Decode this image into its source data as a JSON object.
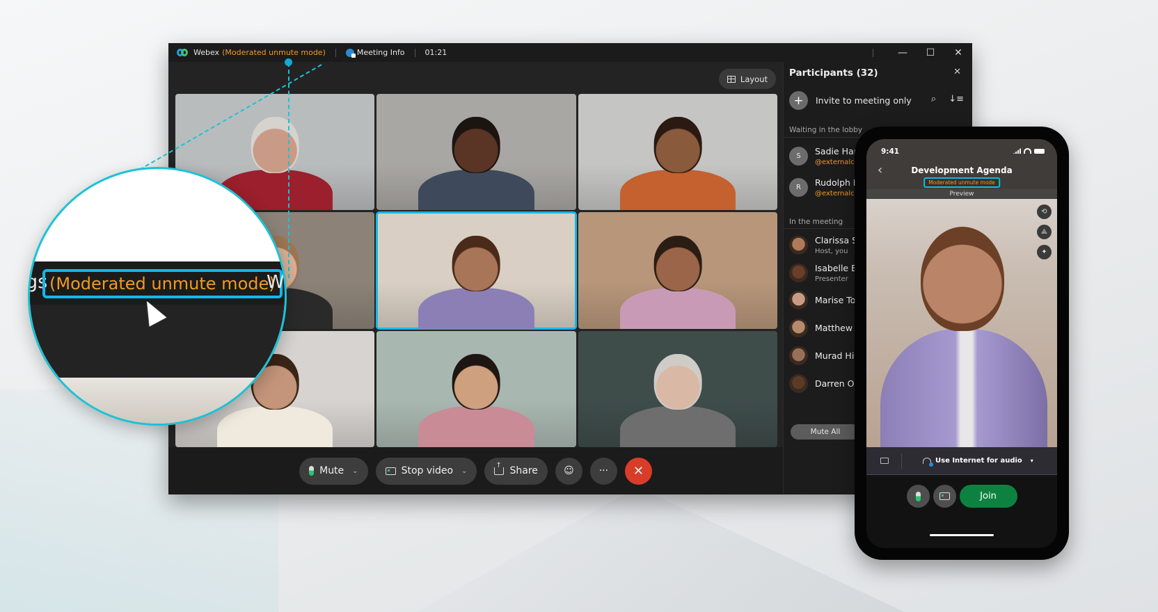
{
  "window": {
    "app_name": "Webex",
    "mode_label": "(Moderated unmute mode)",
    "meeting_info_label": "Meeting Info",
    "timer": "01:21",
    "controls": {
      "minimize": "—",
      "maximize": "☐",
      "close": "✕"
    }
  },
  "stage": {
    "layout_label": "Layout",
    "tiles": [
      {
        "name": "video-tile-1",
        "bg": "#b9bcbd",
        "skin": "#c99a85",
        "hair": "#d6d3cf",
        "clothes": "#9b1f2c",
        "active": false
      },
      {
        "name": "video-tile-2",
        "bg": "#a9a7a3",
        "skin": "#5a3424",
        "hair": "#1b1411",
        "clothes": "#3e4a5c",
        "active": false
      },
      {
        "name": "video-tile-3",
        "bg": "#c5c5c3",
        "skin": "#8a5a3d",
        "hair": "#2a1a12",
        "clothes": "#c4612f",
        "active": false
      },
      {
        "name": "video-tile-4",
        "bg": "#8c8278",
        "skin": "#d8b096",
        "hair": "#9e7552",
        "clothes": "#2a2a2a",
        "active": false
      },
      {
        "name": "video-tile-5",
        "bg": "#d9cfc4",
        "skin": "#a87558",
        "hair": "#4a2a18",
        "clothes": "#8b7fb6",
        "active": true
      },
      {
        "name": "video-tile-6",
        "bg": "#b7967a",
        "skin": "#9a6548",
        "hair": "#2b1c14",
        "clothes": "#c99ab5",
        "active": false
      },
      {
        "name": "video-tile-7",
        "bg": "#d6d3d0",
        "skin": "#c4957a",
        "hair": "#3a2416",
        "clothes": "#efe9de",
        "active": false
      },
      {
        "name": "video-tile-8",
        "bg": "#a9b7b1",
        "skin": "#cfa07e",
        "hair": "#1e1612",
        "clothes": "#c98b96",
        "active": false
      },
      {
        "name": "video-tile-9",
        "bg": "#3e4c4a",
        "skin": "#d9b9a6",
        "hair": "#cfcbc6",
        "clothes": "#6e6e6e",
        "active": false
      }
    ]
  },
  "controls": {
    "mute_label": "Mute",
    "stop_video_label": "Stop video",
    "share_label": "Share",
    "reactions_icon": "☺",
    "more_icon": "···",
    "end_icon": "✕",
    "chevron": "⌄"
  },
  "participants": {
    "title": "Participants (32)",
    "close_icon": "✕",
    "invite_label": "Invite to meeting only",
    "search_icon": "⌕",
    "sort_icon": "↓≡",
    "lobby_label": "Waiting in the lobby",
    "lobby": [
      {
        "initial": "S",
        "name": "Sadie Harr",
        "sub": "@externalcor"
      },
      {
        "initial": "R",
        "name": "Rudolph Ib",
        "sub": "@externalcor"
      }
    ],
    "meeting_label": "In the meeting",
    "in_meeting": [
      {
        "name": "Clarissa Sm",
        "sub": "Host, you",
        "color": "#b07a5a"
      },
      {
        "name": "Isabelle Br",
        "sub": "Presenter",
        "color": "#6a3e2a"
      },
      {
        "name": "Marise Tor",
        "sub": "",
        "color": "#c89c84"
      },
      {
        "name": "Matthew B",
        "sub": "",
        "color": "#b58a6e"
      },
      {
        "name": "Murad Hig",
        "sub": "",
        "color": "#9a7058"
      },
      {
        "name": "Darren Ow",
        "sub": "",
        "color": "#5b3a28"
      }
    ],
    "mute_all_label": "Mute All"
  },
  "phone": {
    "time": "9:41",
    "back_icon": "‹",
    "title": "Development Agenda",
    "mode_label": "Moderated unmute mode",
    "preview_label": "Preview",
    "side_icons": [
      "⟲",
      "⟁",
      "✦"
    ],
    "audio_label": "Use Internet for audio",
    "caret": "▾",
    "join_label": "Join"
  },
  "magnifier": {
    "pre_text": "gs",
    "mode_label": "(Moderated unmute mode)",
    "post_text": "W"
  },
  "colors": {
    "accent_cyan": "#13b8e8",
    "mode_orange": "#f39a1e",
    "end_red": "#d93d2a",
    "join_green": "#0d8240"
  }
}
